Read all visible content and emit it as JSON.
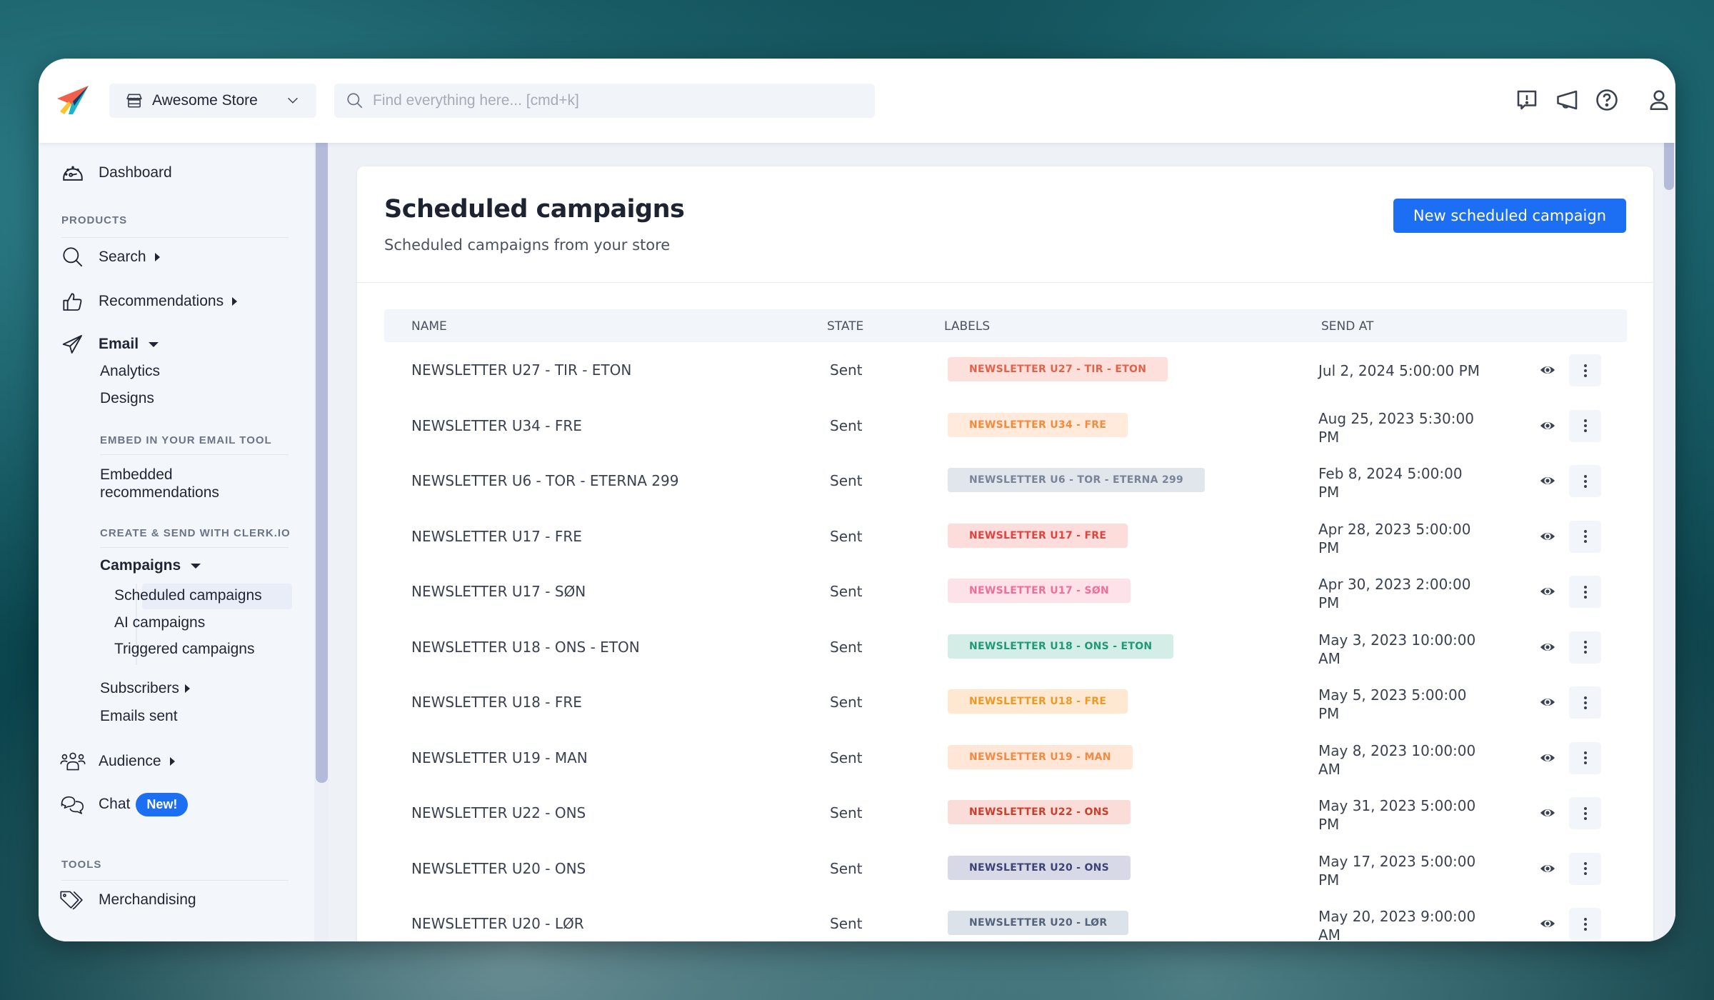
{
  "header": {
    "store_name": "Awesome Store",
    "search_placeholder": "Find everything here... [cmd+k]",
    "icons": [
      "feedback-icon",
      "announcements-icon",
      "help-icon",
      "user-icon"
    ]
  },
  "sidebar": {
    "dashboard": "Dashboard",
    "products_heading": "PRODUCTS",
    "search": "Search",
    "recommendations": "Recommendations",
    "email": "Email",
    "analytics": "Analytics",
    "designs": "Designs",
    "embed_heading": "EMBED IN YOUR EMAIL TOOL",
    "embedded_line1": "Embedded",
    "embedded_line2": "recommendations",
    "create_heading": "CREATE & SEND WITH CLERK.IO",
    "campaigns": "Campaigns",
    "scheduled_campaigns": "Scheduled campaigns",
    "ai_campaigns": "AI campaigns",
    "triggered_campaigns": "Triggered campaigns",
    "subscribers": "Subscribers",
    "emails_sent": "Emails sent",
    "audience": "Audience",
    "chat": "Chat",
    "chat_badge": "New!",
    "tools_heading": "TOOLS",
    "merchandising": "Merchandising"
  },
  "main": {
    "title": "Scheduled campaigns",
    "subtitle": "Scheduled campaigns from your store",
    "new_button": "New scheduled campaign",
    "columns": {
      "name": "NAME",
      "state": "STATE",
      "labels": "LABELS",
      "send_at": "SEND AT"
    },
    "rows": [
      {
        "name": "NEWSLETTER U27 - TIR - ETON",
        "state": "Sent",
        "label": "NEWSLETTER U27 - TIR - ETON",
        "label_bg": "#fde0dc",
        "label_fg": "#e0634a",
        "send_1": "Jul 2, 2024 5:00:00 PM",
        "send_2": ""
      },
      {
        "name": "NEWSLETTER U34 - FRE",
        "state": "Sent",
        "label": "NEWSLETTER U34 - FRE",
        "label_bg": "#ffeadb",
        "label_fg": "#f38b3d",
        "send_1": "Aug 25, 2023 5:30:00",
        "send_2": "PM"
      },
      {
        "name": "NEWSLETTER U6 - TOR - ETERNA 299",
        "state": "Sent",
        "label": "NEWSLETTER U6 - TOR - ETERNA 299",
        "label_bg": "#e1e5ec",
        "label_fg": "#7a8497",
        "send_1": "Feb 8, 2024 5:00:00",
        "send_2": "PM"
      },
      {
        "name": "NEWSLETTER U17 - FRE",
        "state": "Sent",
        "label": "NEWSLETTER U17 - FRE",
        "label_bg": "#fddcdc",
        "label_fg": "#e0443e",
        "send_1": "Apr 28, 2023 5:00:00",
        "send_2": "PM"
      },
      {
        "name": "NEWSLETTER U17 - SØN",
        "state": "Sent",
        "label": "NEWSLETTER U17 - SØN",
        "label_bg": "#fde2ea",
        "label_fg": "#ef6f96",
        "send_1": "Apr 30, 2023 2:00:00",
        "send_2": "PM"
      },
      {
        "name": "NEWSLETTER U18 - ONS - ETON",
        "state": "Sent",
        "label": "NEWSLETTER U18 - ONS - ETON",
        "label_bg": "#d4ede6",
        "label_fg": "#1f9a74",
        "send_1": "May 3, 2023 10:00:00",
        "send_2": "AM"
      },
      {
        "name": "NEWSLETTER U18 - FRE",
        "state": "Sent",
        "label": "NEWSLETTER U18 - FRE",
        "label_bg": "#ffe8d2",
        "label_fg": "#eb9b25",
        "send_1": "May 5, 2023 5:00:00",
        "send_2": "PM"
      },
      {
        "name": "NEWSLETTER U19 - MAN",
        "state": "Sent",
        "label": "NEWSLETTER U19 - MAN",
        "label_bg": "#ffe6d6",
        "label_fg": "#f28a45",
        "send_1": "May 8, 2023 10:00:00",
        "send_2": "AM"
      },
      {
        "name": "NEWSLETTER U22 - ONS",
        "state": "Sent",
        "label": "NEWSLETTER U22 - ONS",
        "label_bg": "#fadcd8",
        "label_fg": "#c9402d",
        "send_1": "May 31, 2023 5:00:00",
        "send_2": "PM"
      },
      {
        "name": "NEWSLETTER U20 - ONS",
        "state": "Sent",
        "label": "NEWSLETTER U20 - ONS",
        "label_bg": "#d8d9e6",
        "label_fg": "#3e4375",
        "send_1": "May 17, 2023 5:00:00",
        "send_2": "PM"
      },
      {
        "name": "NEWSLETTER U20 - LØR",
        "state": "Sent",
        "label": "NEWSLETTER U20 - LØR",
        "label_bg": "#dce2ea",
        "label_fg": "#54637a",
        "send_1": "May 20, 2023 9:00:00",
        "send_2": "AM"
      }
    ]
  },
  "colors": {
    "accent": "#1c6ef2",
    "sidebar_bg": "#f3f6fa",
    "scrollbar_thumb": "#b3bbd8"
  }
}
